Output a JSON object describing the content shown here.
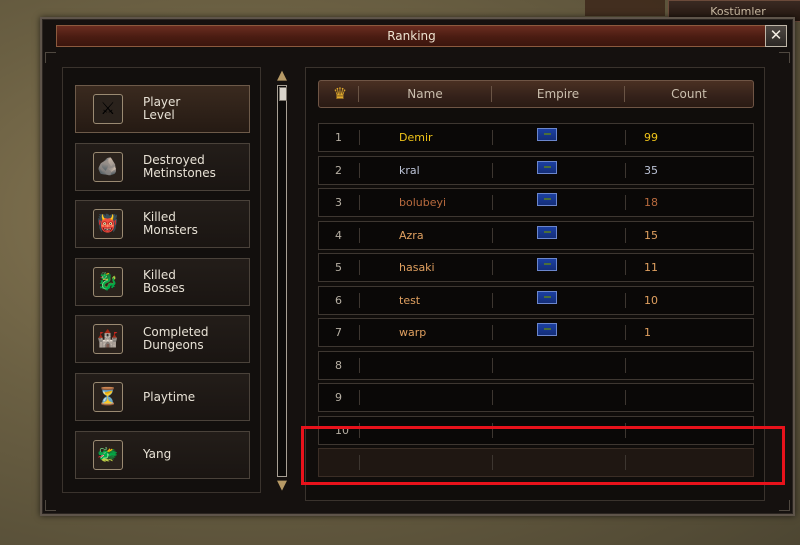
{
  "background": {
    "tab_label": "Kostümler"
  },
  "window": {
    "title": "Ranking",
    "close_label": "✕"
  },
  "categories": [
    {
      "label": "Player\nLevel",
      "icon": "player-level-icon",
      "glyph": "⚔",
      "active": true
    },
    {
      "label": "Destroyed\nMetinstones",
      "icon": "metinstone-icon",
      "glyph": "🪨",
      "active": false
    },
    {
      "label": "Killed\nMonsters",
      "icon": "monster-icon",
      "glyph": "👹",
      "active": false
    },
    {
      "label": "Killed\nBosses",
      "icon": "boss-icon",
      "glyph": "🐉",
      "active": false
    },
    {
      "label": "Completed\nDungeons",
      "icon": "dungeon-icon",
      "glyph": "🏰",
      "active": false
    },
    {
      "label": "Playtime",
      "icon": "playtime-icon",
      "glyph": "⏳",
      "active": false
    },
    {
      "label": "Yang",
      "icon": "yang-icon",
      "glyph": "🐲",
      "active": false
    }
  ],
  "table": {
    "columns": [
      "Name",
      "Empire",
      "Count"
    ],
    "rows": [
      {
        "rank": "1",
        "name": "Demir",
        "empire": "blue",
        "count": "99",
        "color": "#f0c419"
      },
      {
        "rank": "2",
        "name": "kral",
        "empire": "blue",
        "count": "35",
        "color": "#bcc3d6"
      },
      {
        "rank": "3",
        "name": "bolubeyi",
        "empire": "blue",
        "count": "18",
        "color": "#b86a3e"
      },
      {
        "rank": "4",
        "name": "Azra",
        "empire": "blue",
        "count": "15",
        "color": "#e0a060"
      },
      {
        "rank": "5",
        "name": "hasaki",
        "empire": "blue",
        "count": "11",
        "color": "#e0a060"
      },
      {
        "rank": "6",
        "name": "test",
        "empire": "blue",
        "count": "10",
        "color": "#e0a060"
      },
      {
        "rank": "7",
        "name": "warp",
        "empire": "blue",
        "count": "1",
        "color": "#e0a060"
      },
      {
        "rank": "8",
        "name": "",
        "empire": "",
        "count": "",
        "color": "#b7b0a4"
      },
      {
        "rank": "9",
        "name": "",
        "empire": "",
        "count": "",
        "color": "#b7b0a4"
      },
      {
        "rank": "10",
        "name": "",
        "empire": "",
        "count": "",
        "color": "#b7b0a4"
      },
      {
        "rank": "",
        "name": "",
        "empire": "",
        "count": "",
        "color": "#b7b0a4"
      }
    ]
  },
  "colors": {
    "highlight": "#e8121b",
    "crown": "#e1aa2c"
  }
}
